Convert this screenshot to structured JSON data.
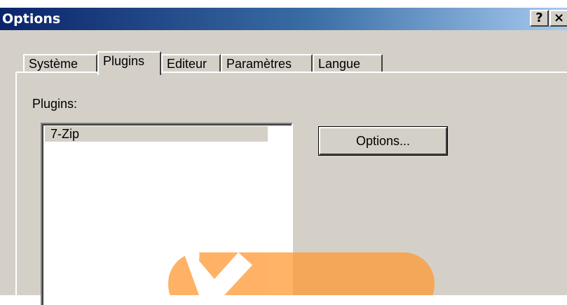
{
  "window": {
    "title": "Options",
    "help_label": "?",
    "close_label": "×"
  },
  "tabs": [
    {
      "label": "Système",
      "active": false
    },
    {
      "label": "Plugins",
      "active": true
    },
    {
      "label": "Editeur",
      "active": false
    },
    {
      "label": "Paramètres",
      "active": false
    },
    {
      "label": "Langue",
      "active": false
    }
  ],
  "plugins_panel": {
    "label": "Plugins:",
    "items": [
      {
        "label": "7-Zip",
        "selected": true
      }
    ],
    "options_button": "Options..."
  },
  "colors": {
    "title_gradient_start": "#0a246a",
    "title_gradient_end": "#a6caf0",
    "face": "#d4d0c8",
    "watermark": "#ff9933"
  }
}
